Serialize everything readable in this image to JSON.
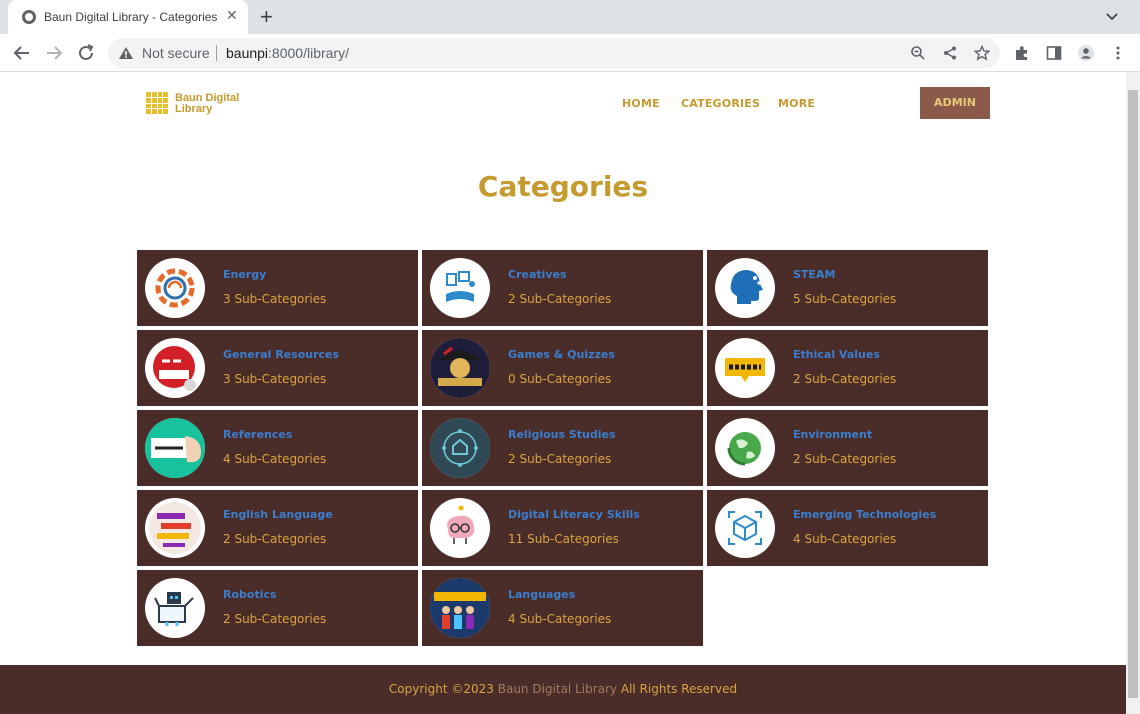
{
  "browser": {
    "tab_title": "Baun Digital Library - Categories",
    "new_tab": "+",
    "close": "✕",
    "security_status": "Not secure",
    "url_host": "baunpi",
    "url_rest": ":8000/library/"
  },
  "site": {
    "logo_line1": "Baun Digital",
    "logo_line2": "Library",
    "nav": {
      "home": "HOME",
      "categories": "CATEGORIES",
      "more": "MORE"
    },
    "admin_label": "ADMIN",
    "page_title": "Categories"
  },
  "categories": [
    {
      "name": "Energy",
      "count": "3 Sub-Categories",
      "icon": "energy-gear-icon"
    },
    {
      "name": "Creatives",
      "count": "2 Sub-Categories",
      "icon": "creatives-book-icon"
    },
    {
      "name": "STEAM",
      "count": "5 Sub-Categories",
      "icon": "steam-head-icon"
    },
    {
      "name": "General Resources",
      "count": "3 Sub-Categories",
      "icon": "learn-more-icon"
    },
    {
      "name": "Games & Quizzes",
      "count": "0 Sub-Categories",
      "icon": "games-pirate-icon"
    },
    {
      "name": "Ethical Values",
      "count": "2 Sub-Categories",
      "icon": "ethics-badge-icon"
    },
    {
      "name": "References",
      "count": "4 Sub-Categories",
      "icon": "reference-card-icon"
    },
    {
      "name": "Religious Studies",
      "count": "2 Sub-Categories",
      "icon": "religious-network-icon"
    },
    {
      "name": "Environment",
      "count": "2 Sub-Categories",
      "icon": "environment-globe-icon"
    },
    {
      "name": "English Language",
      "count": "2 Sub-Categories",
      "icon": "speak-english-icon"
    },
    {
      "name": "Digital Literacy Skills",
      "count": "11 Sub-Categories",
      "icon": "digital-brain-icon"
    },
    {
      "name": "Emerging Technologies",
      "count": "4 Sub-Categories",
      "icon": "emerging-cube-icon"
    },
    {
      "name": "Robotics",
      "count": "2 Sub-Categories",
      "icon": "robotics-robot-icon"
    },
    {
      "name": "Languages",
      "count": "4 Sub-Categories",
      "icon": "languages-people-icon"
    }
  ],
  "footer": {
    "prefix": "Copyright ©2023",
    "brand": "Baun Digital Library",
    "suffix": "All Rights Reserved"
  },
  "colors": {
    "card_bg": "#4a2c28",
    "accent_gold": "#c59a2e",
    "link_blue": "#3a7ecf",
    "count_gold": "#d9a441",
    "admin_bg": "#8c5a4a"
  }
}
